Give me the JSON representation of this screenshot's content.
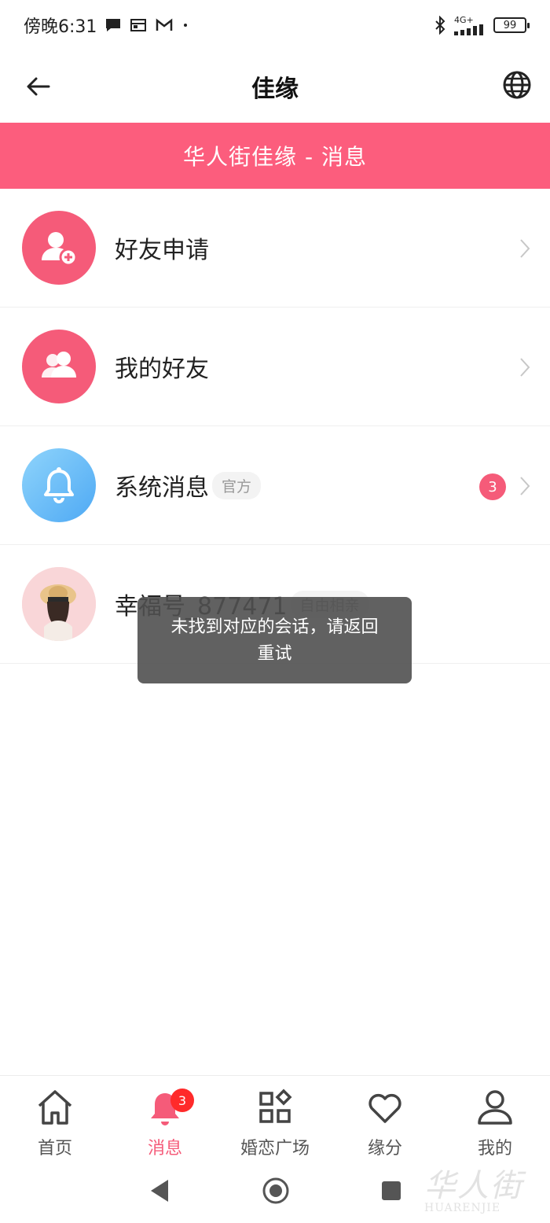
{
  "status_bar": {
    "time": "傍晚6:31",
    "network": "4G+",
    "battery": "99"
  },
  "header": {
    "title": "佳缘"
  },
  "banner": {
    "text": "华人街佳缘 - 消息"
  },
  "list": [
    {
      "label": "好友申请",
      "icon": "add-friend-icon"
    },
    {
      "label": "我的好友",
      "icon": "friends-icon"
    },
    {
      "label": "系统消息",
      "tag": "官方",
      "badge": "3",
      "icon": "bell-icon"
    },
    {
      "label": "幸福号_877471",
      "tag": "自由相亲",
      "icon": "user-photo"
    }
  ],
  "toast": {
    "text": "未找到对应的会话，请返回重试"
  },
  "tabs": [
    {
      "label": "首页",
      "icon": "home-icon"
    },
    {
      "label": "消息",
      "icon": "bell-icon",
      "badge": "3",
      "active": true
    },
    {
      "label": "婚恋广场",
      "icon": "grid-icon"
    },
    {
      "label": "缘分",
      "icon": "heart-icon"
    },
    {
      "label": "我的",
      "icon": "person-icon"
    }
  ],
  "watermark": {
    "brand": "华人街",
    "text": "HUARENJIE"
  },
  "colors": {
    "accent": "#f55b79",
    "banner": "#fc5d7d",
    "badge": "#ff2a2a"
  }
}
